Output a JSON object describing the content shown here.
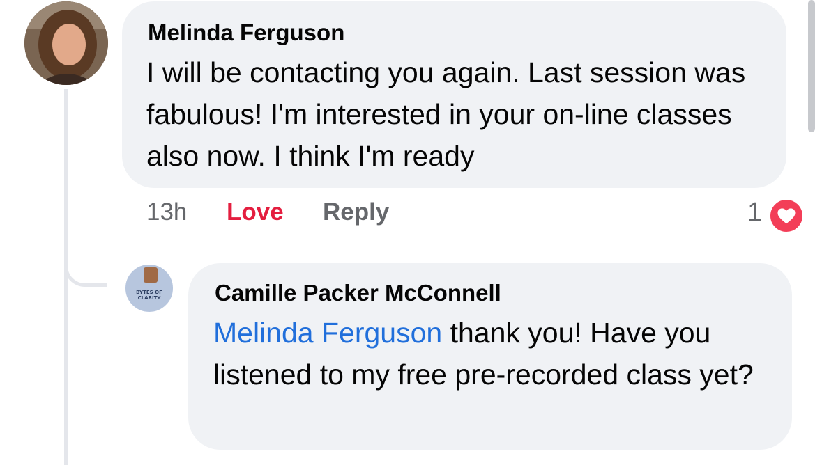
{
  "colors": {
    "bubble_bg": "#f0f2f5",
    "love_red": "#e41e3f",
    "mention_blue": "#216fdb",
    "meta_gray": "#65676b",
    "heart_badge": "#f33e58"
  },
  "comment": {
    "author": "Melinda Ferguson",
    "text": "I will be contacting you again. Last session was fabulous! I'm interested in your on-line classes also now. I think I'm ready",
    "timestamp": "13h",
    "reaction_label": "Love",
    "reply_label": "Reply",
    "reaction_count": "1",
    "reaction_icon": "heart-icon"
  },
  "reply": {
    "author": "Camille Packer McConnell",
    "mention": "Melinda Ferguson",
    "text": " thank you! Have you listened to my free pre-recorded class yet?",
    "avatar_brand": "BYTES OF CLARITY"
  }
}
